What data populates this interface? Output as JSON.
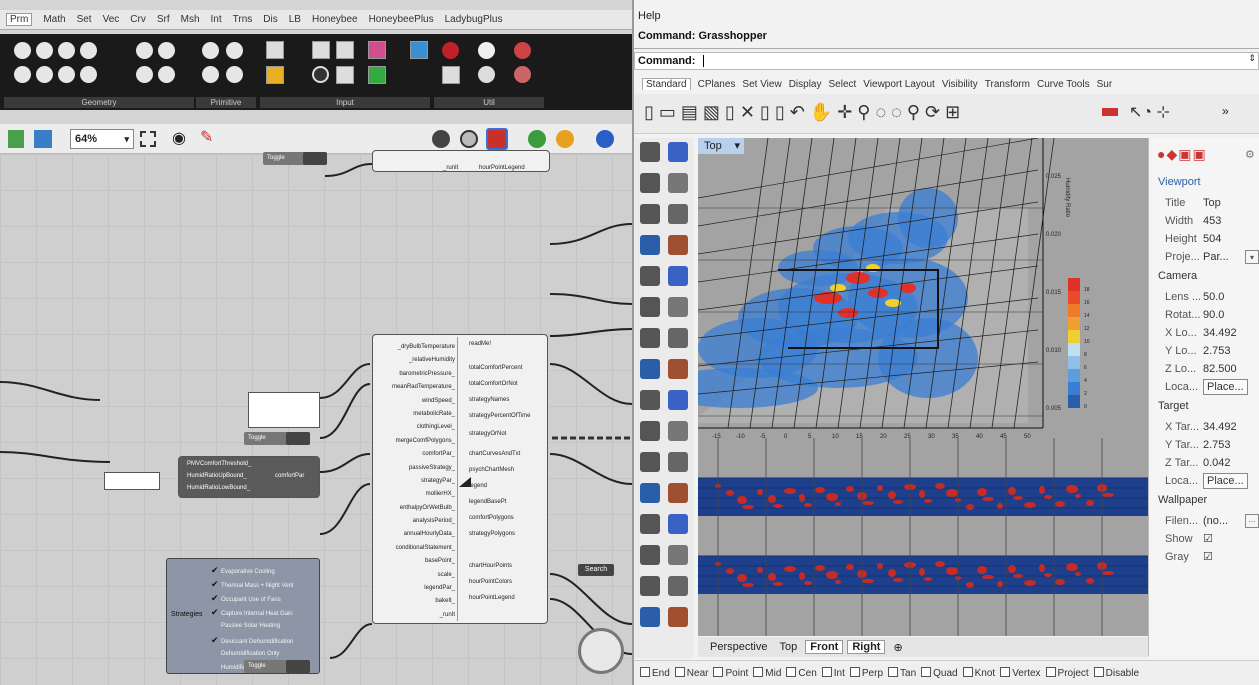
{
  "gh": {
    "tabs": [
      "Prm",
      "Math",
      "Set",
      "Vec",
      "Crv",
      "Srf",
      "Msh",
      "Int",
      "Trns",
      "Dis",
      "LB",
      "Honeybee",
      "HoneybeePlus",
      "LadybugPlus"
    ],
    "groups": [
      "Geometry",
      "Primitive",
      "Input",
      "Util"
    ],
    "zoom": "64%",
    "toggle_label": "Toggle",
    "toggle_value": "True",
    "legend_label": "hourPointLegend",
    "legend_input": "_runIt",
    "component": {
      "inputs": [
        "_dryBulbTemperature",
        "_relativeHumidity",
        "barometricPressure_",
        "meanRadTemperature_",
        "windSpeed_",
        "metabolicRate_",
        "clothingLevel_",
        "mergeComfPolygons_",
        "comfortPar_",
        "passiveStrategy_",
        "strategyPar_",
        "mollierHX_",
        "enthalpyOrWetBulb_",
        "analysisPeriod_",
        "annualHourlyData_",
        "conditionalStatement_",
        "basePoint_",
        "scale_",
        "legendPar_",
        "bakeIt_",
        "_runIt"
      ],
      "outputs": [
        "readMe!",
        "totalComfortPercent",
        "totalComfortOrNot",
        "strategyNames",
        "strategyPercentOfTime",
        "strategyOrNot",
        "chartCurvesAndTxt",
        "psychChartMesh",
        "legend",
        "legendBasePt",
        "comfortPolygons",
        "strategyPolygons",
        "chartHourPoints",
        "hourPointColors",
        "hourPointLegend"
      ]
    },
    "comfort_inputs": [
      "PMVComfortThreshold_",
      "HumidRatioUpBound_",
      "HumidRatioLowBound_"
    ],
    "comfort_par_label": "comfortPar",
    "strategies_label": "Strategies",
    "strategies": [
      {
        "label": "Evaporative Cooling",
        "checked": true
      },
      {
        "label": "Thermal Mass + Night Vent",
        "checked": true
      },
      {
        "label": "Occupant Use of Fans",
        "checked": true
      },
      {
        "label": "Capture Internal Heat Gain",
        "checked": true
      },
      {
        "label": "Passive Solar Heating",
        "checked": false
      },
      {
        "label": "Desiccant Dehumidification",
        "checked": true
      },
      {
        "label": "Dehumidification Only",
        "checked": false
      },
      {
        "label": "Humidification Only",
        "checked": false
      }
    ],
    "search_label": "Search"
  },
  "rhino": {
    "help": "Help",
    "command_history": "Command: Grasshopper",
    "command_label": "Command:",
    "tabs": [
      "Standard",
      "CPlanes",
      "Set View",
      "Display",
      "Select",
      "Viewport Layout",
      "Visibility",
      "Transform",
      "Curve Tools",
      "Sur"
    ],
    "viewport_name": "Top",
    "axis_label": "Humidity Ratio",
    "y_ticks": [
      "0.025",
      "0.020",
      "0.015",
      "0.010",
      "0.005"
    ],
    "x_ticks": [
      "-15",
      "-10",
      "-5",
      "0",
      "5",
      "10",
      "15",
      "20",
      "25",
      "30",
      "35",
      "40",
      "45",
      "50"
    ],
    "legend_ticks": [
      "0",
      "2",
      "4",
      "6",
      "8",
      "10",
      "12",
      "14",
      "16",
      "18"
    ],
    "viewport_tabs": [
      "Perspective",
      "Top",
      "Front",
      "Right"
    ],
    "properties": {
      "viewport_header": "Viewport",
      "title_label": "Title",
      "title_value": "Top",
      "width_label": "Width",
      "width_value": "453",
      "height_label": "Height",
      "height_value": "504",
      "proj_label": "Proje...",
      "proj_value": "Par...",
      "camera_header": "Camera",
      "lens_label": "Lens ...",
      "lens_value": "50.0",
      "rot_label": "Rotat...",
      "rot_value": "90.0",
      "xl_label": "X Lo...",
      "xl_value": "34.492",
      "yl_label": "Y Lo...",
      "yl_value": "2.753",
      "zl_label": "Z Lo...",
      "zl_value": "82.500",
      "loc_label": "Loca...",
      "place_label": "Place...",
      "target_header": "Target",
      "xt_label": "X Tar...",
      "xt_value": "34.492",
      "yt_label": "Y Tar...",
      "yt_value": "2.753",
      "zt_label": "Z Tar...",
      "zt_value": "0.042",
      "tloc_label": "Loca...",
      "tplace_label": "Place...",
      "wallpaper_header": "Wallpaper",
      "file_label": "Filen...",
      "file_value": "(no...",
      "show_label": "Show",
      "gray_label": "Gray",
      "show_checked": true,
      "gray_checked": true
    },
    "osnaps": [
      "End",
      "Near",
      "Point",
      "Mid",
      "Cen",
      "Int",
      "Perp",
      "Tan",
      "Quad",
      "Knot",
      "Vertex",
      "Project",
      "Disable"
    ],
    "colors": {
      "blue_band": "#1e3f8c",
      "hot": "#d62a1a",
      "cool": "#4a8fd6"
    }
  }
}
